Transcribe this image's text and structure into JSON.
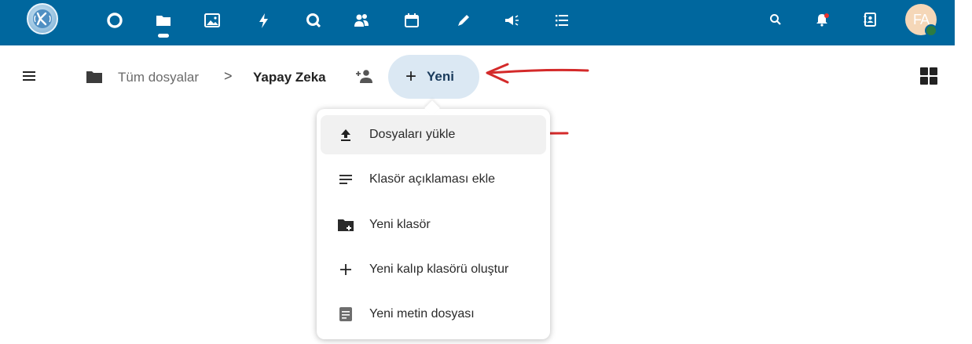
{
  "header": {
    "apps": [
      {
        "name": "dashboard-app-icon",
        "icon": "circle"
      },
      {
        "name": "files-app-icon",
        "icon": "folder",
        "active": true
      },
      {
        "name": "photos-app-icon",
        "icon": "image"
      },
      {
        "name": "activity-app-icon",
        "icon": "bolt"
      },
      {
        "name": "search-app-icon",
        "icon": "magnifier"
      },
      {
        "name": "contacts-app-icon",
        "icon": "people"
      },
      {
        "name": "calendar-app-icon",
        "icon": "calendar"
      },
      {
        "name": "notes-app-icon",
        "icon": "pencil"
      },
      {
        "name": "announcements-app-icon",
        "icon": "megaphone"
      },
      {
        "name": "tasks-app-icon",
        "icon": "list"
      }
    ],
    "avatar_initials": "FA",
    "colors": {
      "bar": "#00679e",
      "status": "#2d7b41",
      "notification": "#e9322d"
    }
  },
  "breadcrumb": {
    "root_label": "Tüm dosyalar",
    "separator": ">",
    "current": "Yapay Zeka"
  },
  "new_button": {
    "label": "Yeni",
    "plus": "+"
  },
  "new_menu": {
    "items": [
      {
        "label": "Dosyaları yükle",
        "icon": "upload-icon"
      },
      {
        "label": "Klasör açıklaması ekle",
        "icon": "text-lines-icon"
      },
      {
        "label": "Yeni klasör",
        "icon": "folder-plus-icon"
      },
      {
        "label": "Yeni kalıp klasörü oluştur",
        "icon": "plus-icon"
      },
      {
        "label": "Yeni metin dosyası",
        "icon": "text-file-icon"
      }
    ]
  },
  "annotations": {
    "arrow_color": "#d42a2a"
  }
}
